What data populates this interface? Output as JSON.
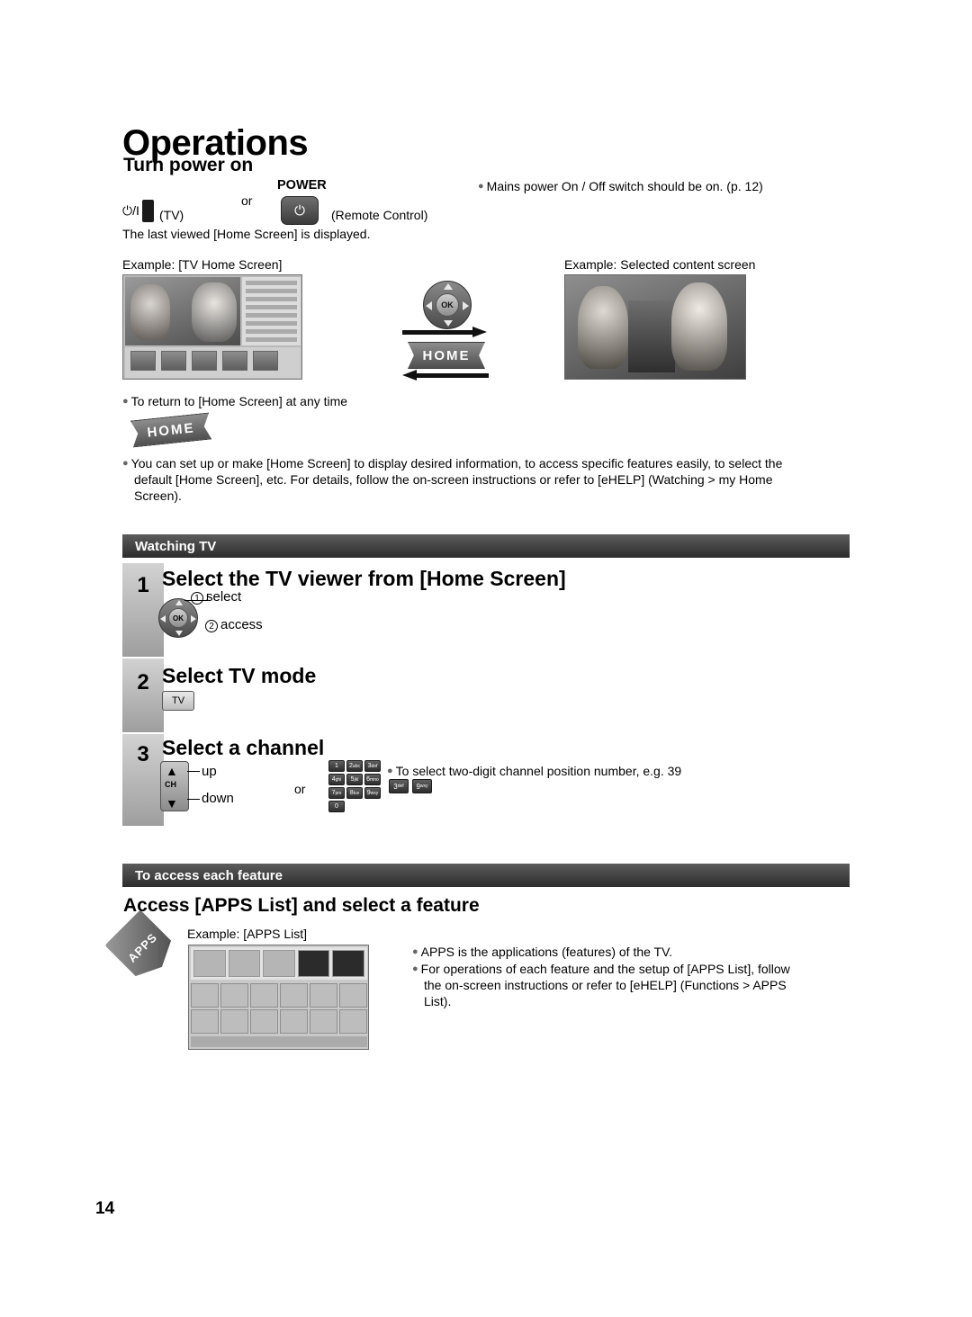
{
  "page": {
    "title": "Operations",
    "number": "14"
  },
  "turn_power": {
    "heading": "Turn power on",
    "power_label": "POWER",
    "or": "or",
    "tv_glyph": "⏻/I",
    "tv_paren": "(TV)",
    "remote_paren": "(Remote Control)",
    "remote_icon": "power-icon",
    "mains_note": "Mains power On / Off switch should be on. (p. 12)",
    "last_viewed": "The last viewed [Home Screen] is displayed.",
    "example_tv_home": "Example: [TV Home Screen]",
    "example_selected": "Example: Selected content screen",
    "home_button_label": "HOME",
    "to_return": "To return to [Home Screen] at any time",
    "paragraph_1": "You can set up or make [Home Screen] to display desired information, to access specific features easily, to select the",
    "paragraph_2": "default [Home Screen], etc. For details, follow the on-screen instructions or refer to [eHELP] (Watching > my Home",
    "paragraph_3": "Screen)."
  },
  "watching_tv": {
    "bar_label": "Watching TV",
    "steps": [
      {
        "num": "1",
        "heading": "Select the TV viewer from [Home Screen]",
        "cap1": "select",
        "cap1_num": "1",
        "cap2": "access",
        "cap2_num": "2",
        "ok_label": "OK"
      },
      {
        "num": "2",
        "heading": "Select TV mode",
        "button_label": "TV"
      },
      {
        "num": "3",
        "heading": "Select a channel",
        "up_label": "up",
        "down_label": "down",
        "ch_label": "CH",
        "or": "or",
        "two_digit_note": "To select two-digit channel position number, e.g. 39"
      }
    ],
    "keypad": [
      [
        "1",
        "2",
        "3"
      ],
      [
        "4",
        "5",
        "6"
      ],
      [
        "7",
        "8",
        "9"
      ],
      [
        "0",
        "",
        ""
      ]
    ],
    "keypad_subs": [
      [
        "",
        "abc",
        "def"
      ],
      [
        "ghi",
        "jkl",
        "mno"
      ],
      [
        "pqrs",
        "tuv",
        "wxyz"
      ],
      [
        "",
        "",
        ""
      ]
    ],
    "example_keys": [
      {
        "digit": "3",
        "sub": "def"
      },
      {
        "digit": "9",
        "sub": "wxyz"
      }
    ]
  },
  "access_feature": {
    "bar_label": "To access each feature",
    "heading": "Access [APPS List] and select a feature",
    "apps_badge": "APPS",
    "example_label": "Example: [APPS List]",
    "bullet_1": "APPS is the applications (features) of the TV.",
    "bullet_2a": "For operations of each feature and the setup of [APPS List], follow",
    "bullet_2b": "the on-screen instructions or refer to [eHELP] (Functions > APPS",
    "bullet_2c": "List)."
  }
}
